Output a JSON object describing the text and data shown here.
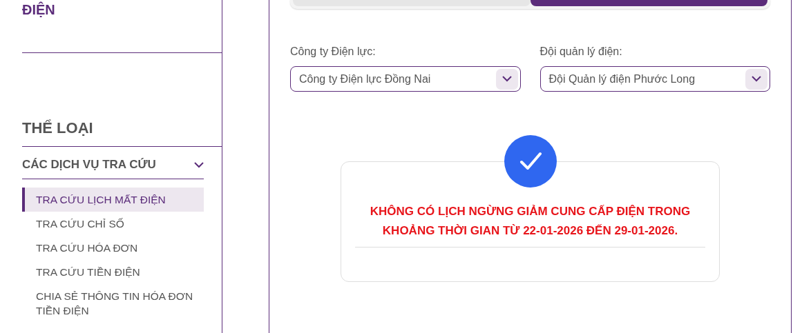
{
  "sidebar": {
    "page_title": "ĐIỆN",
    "section_title": "THỂ LOẠI",
    "category": {
      "label": "CÁC DỊCH VỤ TRA CỨU",
      "expanded": true
    },
    "items": [
      {
        "label": "TRA CỨU LỊCH MẤT ĐIỆN",
        "selected": true
      },
      {
        "label": "TRA CỨU CHỈ SỐ",
        "selected": false
      },
      {
        "label": "TRA CỨU HÓA ĐƠN",
        "selected": false
      },
      {
        "label": "TRA CỨU TIỀN ĐIỆN",
        "selected": false
      },
      {
        "label": "CHIA SẺ THÔNG TIN HÓA ĐƠN TIỀN ĐIỆN",
        "selected": false
      }
    ]
  },
  "segments": [
    {
      "selected": false
    },
    {
      "selected": true
    }
  ],
  "filters": [
    {
      "label": "Công ty Điện lực:",
      "value": "Công ty Điện lực Đồng Nai"
    },
    {
      "label": "Đội quản lý điện:",
      "value": "Đội Quản lý điện Phước Long"
    }
  ],
  "result": {
    "message": "KHÔNG CÓ LỊCH NGỪNG GIẢM CUNG CẤP ĐIỆN TRONG KHOẢNG THỜI GIAN TỪ 22-01-2026 ĐẾN 29-01-2026."
  }
}
